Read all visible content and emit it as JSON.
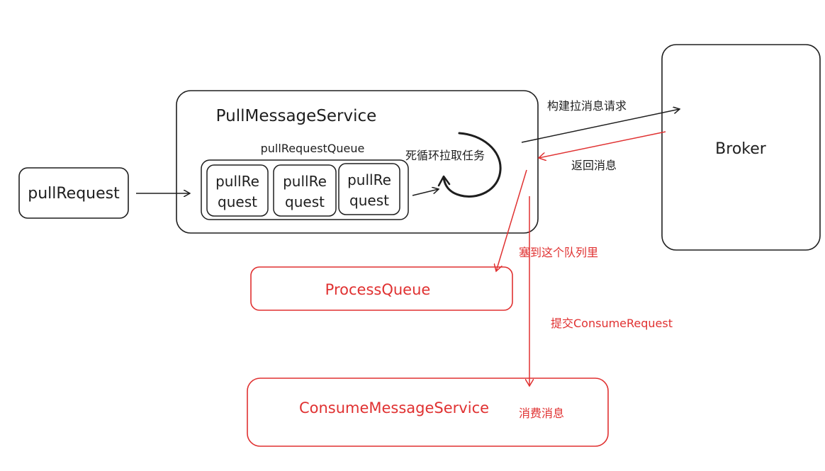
{
  "colors": {
    "ink": "#1e1e1e",
    "accent": "#e03131",
    "background": "#ffffff"
  },
  "nodes": {
    "pull_request": "pullRequest",
    "pull_message_service": "PullMessageService",
    "pull_request_queue": "pullRequestQueue",
    "queue_items": [
      {
        "line1": "pullRe",
        "line2": "quest"
      },
      {
        "line1": "pullRe",
        "line2": "quest"
      },
      {
        "line1": "pullRe",
        "line2": "quest"
      }
    ],
    "broker": "Broker",
    "process_queue": "ProcessQueue",
    "consume_message_service": "ConsumeMessageService"
  },
  "labels": {
    "dead_loop": "死循环拉取任务",
    "build_request": "构建拉消息请求",
    "return_message": "返回消息",
    "put_into_queue": "塞到这个队列里",
    "submit_request": "提交ConsumeRequest",
    "consume_message": "消费消息"
  }
}
